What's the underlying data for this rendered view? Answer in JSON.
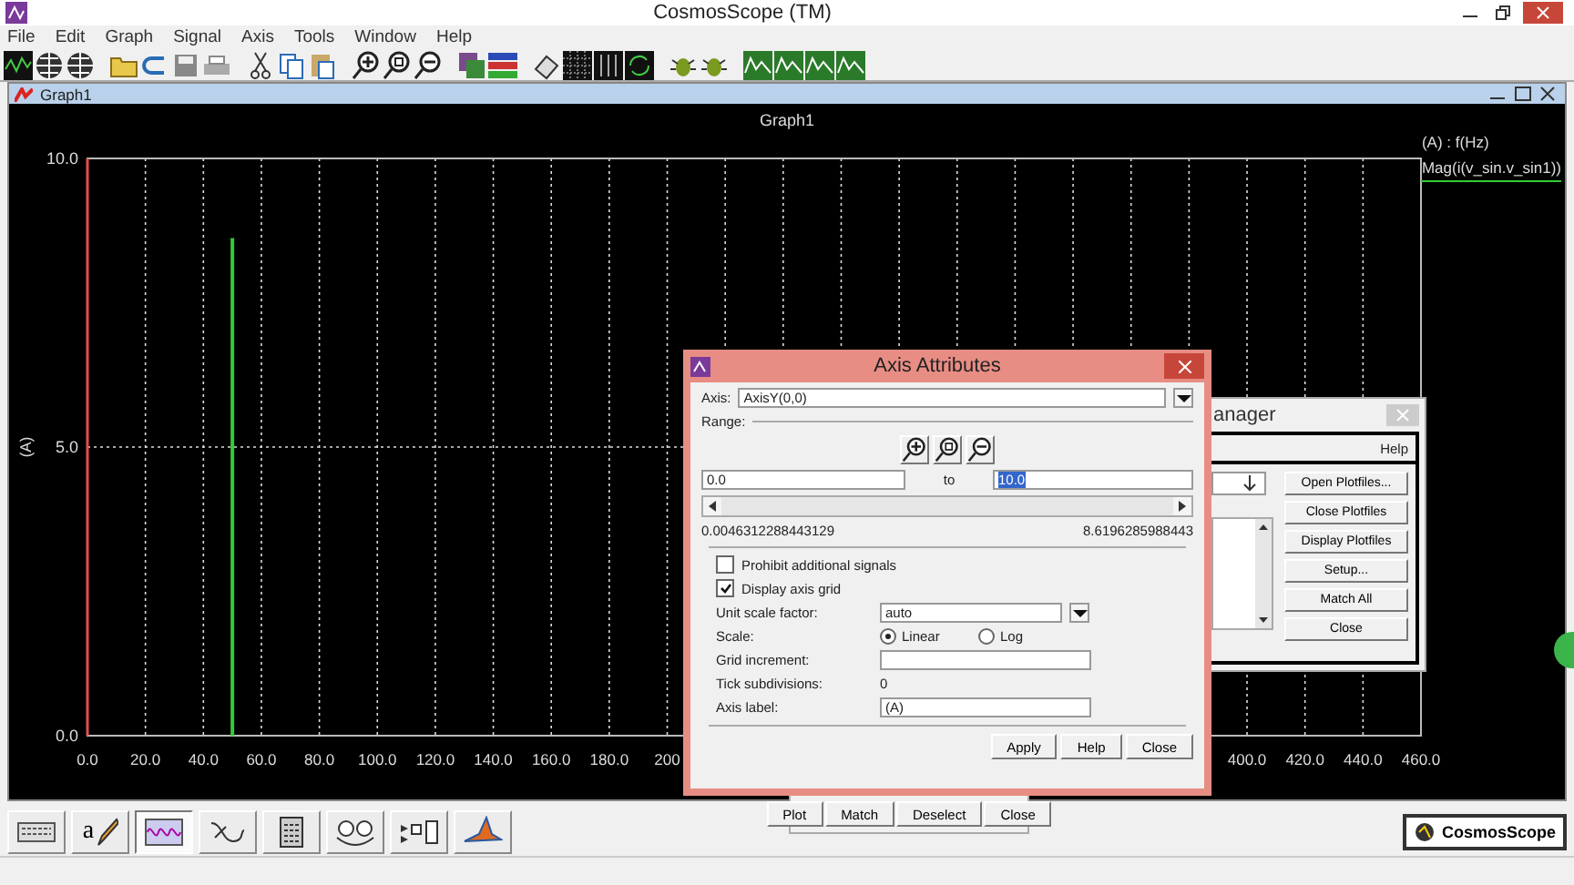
{
  "app": {
    "title": "CosmosScope (TM)"
  },
  "menu": [
    "File",
    "Edit",
    "Graph",
    "Signal",
    "Axis",
    "Tools",
    "Window",
    "Help"
  ],
  "graph_window": {
    "title": "Graph1",
    "legend_axis": "(A) : f(Hz)",
    "chart_data": {
      "type": "bar",
      "title": "Graph1",
      "ylabel": "(A)",
      "grid": true,
      "x": [
        50
      ],
      "series": [
        {
          "name": "Mag(i(v_sin.v_sin1))",
          "color": "#33cc33",
          "values": [
            8.62
          ]
        }
      ],
      "xlim": [
        0,
        460
      ],
      "ylim": [
        0,
        10
      ],
      "xticks": [
        {
          "value": 0,
          "label": "0.0"
        },
        {
          "value": 20,
          "label": "20.0"
        },
        {
          "value": 40,
          "label": "40.0"
        },
        {
          "value": 60,
          "label": "60.0"
        },
        {
          "value": 80,
          "label": "80.0"
        },
        {
          "value": 100,
          "label": "100.0"
        },
        {
          "value": 120,
          "label": "120.0"
        },
        {
          "value": 140,
          "label": "140.0"
        },
        {
          "value": 160,
          "label": "160.0"
        },
        {
          "value": 180,
          "label": "180.0"
        },
        {
          "value": 200,
          "label": "200"
        },
        {
          "value": 400,
          "label": "400.0"
        },
        {
          "value": 420,
          "label": "420.0"
        },
        {
          "value": 440,
          "label": "440.0"
        },
        {
          "value": 460,
          "label": "460.0"
        }
      ],
      "yticks": [
        {
          "value": 0,
          "label": "0.0"
        },
        {
          "value": 5,
          "label": "5.0"
        },
        {
          "value": 10,
          "label": "10.0"
        }
      ]
    }
  },
  "axis_dialog": {
    "title": "Axis Attributes",
    "axis_label": "Axis:",
    "axis_value": "AxisY(0,0)",
    "range_label": "Range:",
    "range_from": "0.0",
    "range_to_word": "to",
    "range_to": "10.0",
    "range_to_highlighted": true,
    "data_min": "0.0046312288443129",
    "data_max": "8.6196285988443",
    "options": [
      {
        "label": "Prohibit additional signals",
        "checked": false
      },
      {
        "label": "Display axis grid",
        "checked": true
      }
    ],
    "unit_label": "Unit scale factor:",
    "unit_value": "auto",
    "scale_label": "Scale:",
    "scale_options": [
      {
        "label": "Linear",
        "selected": true
      },
      {
        "label": "Log",
        "selected": false
      }
    ],
    "grid_label": "Grid increment:",
    "tick_label": "Tick subdivisions:",
    "tick_value": "0",
    "axis_name_label": "Axis label:",
    "axis_name_value": "(A)",
    "buttons": [
      "Apply",
      "Help",
      "Close"
    ]
  },
  "plotfile_manager": {
    "title": "anager",
    "menu": "Help",
    "buttons": [
      "Open Plotfiles...",
      "Close Plotfiles",
      "Display Plotfiles",
      "Setup...",
      "Match All",
      "Close"
    ]
  },
  "signal_buttons": [
    "Plot",
    "Match",
    "Deselect",
    "Close"
  ],
  "bottom_toolbar": [
    {
      "kind": "keyboard",
      "selected": false
    },
    {
      "kind": "annotate",
      "glyph": "a",
      "selected": false
    },
    {
      "kind": "waveform",
      "selected": true
    },
    {
      "kind": "curve",
      "selected": false
    },
    {
      "kind": "calculator",
      "selected": false
    },
    {
      "kind": "circles",
      "selected": false
    },
    {
      "kind": "blocks",
      "selected": false
    },
    {
      "kind": "peak",
      "selected": false
    }
  ],
  "logo": "CosmosScope"
}
